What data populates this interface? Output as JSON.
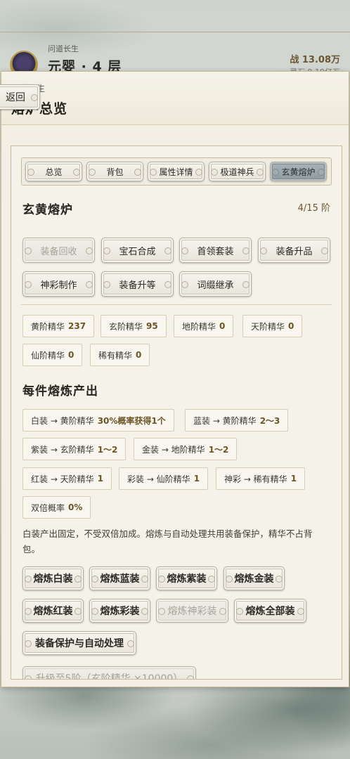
{
  "header": {
    "game_title": "问道长生",
    "realm": "元婴 · 4 层",
    "power": "战 13.08万",
    "power_sub": "灵石 9.19亿万"
  },
  "panel": {
    "subtitle": "问道长生",
    "title": "熔炉总览",
    "back_label": "返回"
  },
  "tabs": [
    {
      "label": "总览",
      "active": false
    },
    {
      "label": "背包",
      "active": false
    },
    {
      "label": "属性详情",
      "active": false
    },
    {
      "label": "极道神兵",
      "active": false
    },
    {
      "label": "玄黄熔炉",
      "active": true
    }
  ],
  "furnace": {
    "title": "玄黄熔炉",
    "stage_value": "4/15",
    "stage_unit": "阶"
  },
  "functions": [
    {
      "label": "装备回收",
      "enabled": false
    },
    {
      "label": "宝石合成",
      "enabled": true
    },
    {
      "label": "首领套装",
      "enabled": true
    },
    {
      "label": "装备升品",
      "enabled": true
    },
    {
      "label": "神彩制作",
      "enabled": true
    },
    {
      "label": "装备升等",
      "enabled": true
    },
    {
      "label": "词缀继承",
      "enabled": true
    }
  ],
  "essences": [
    {
      "label": "黄阶精华",
      "value": "237"
    },
    {
      "label": "玄阶精华",
      "value": "95"
    },
    {
      "label": "地阶精华",
      "value": "0"
    },
    {
      "label": "天阶精华",
      "value": "0"
    },
    {
      "label": "仙阶精华",
      "value": "0"
    },
    {
      "label": "稀有精华",
      "value": "0"
    }
  ],
  "output": {
    "title": "每件熔炼产出",
    "rules": [
      {
        "label": "白装 → 黄阶精华",
        "value": "30%概率获得1个"
      },
      {
        "label": "蓝装 → 黄阶精华",
        "value": "2～3"
      },
      {
        "label": "紫装 → 玄阶精华",
        "value": "1～2"
      },
      {
        "label": "金装 → 地阶精华",
        "value": "1～2"
      },
      {
        "label": "红装 → 天阶精华",
        "value": "1"
      },
      {
        "label": "彩装 → 仙阶精华",
        "value": "1"
      },
      {
        "label": "神彩 → 稀有精华",
        "value": "1"
      },
      {
        "label": "双倍概率",
        "value": "0%"
      }
    ],
    "note": "白装产出固定，不受双倍加成。熔炼与自动处理共用装备保护，精华不占背包。"
  },
  "actions": [
    {
      "label": "熔炼白装",
      "enabled": true
    },
    {
      "label": "熔炼蓝装",
      "enabled": true
    },
    {
      "label": "熔炼紫装",
      "enabled": true
    },
    {
      "label": "熔炼金装",
      "enabled": true
    },
    {
      "label": "熔炼红装",
      "enabled": true
    },
    {
      "label": "熔炼彩装",
      "enabled": true
    },
    {
      "label": "熔炼神彩装",
      "enabled": false
    },
    {
      "label": "熔炼全部装",
      "enabled": true
    },
    {
      "label": "装备保护与自动处理",
      "enabled": true
    }
  ],
  "upgrade": {
    "label": "升级至5阶（玄阶精华 ×10000）",
    "enabled": false
  }
}
